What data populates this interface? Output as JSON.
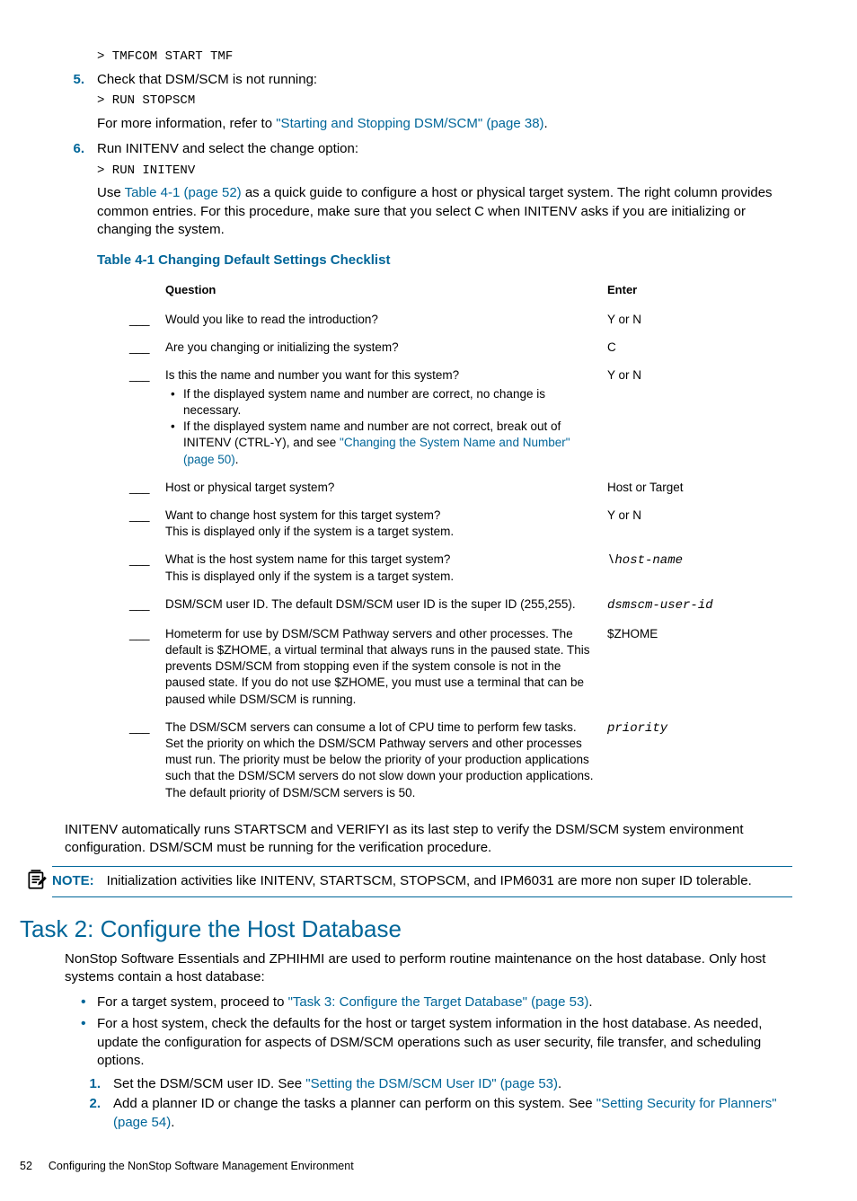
{
  "step5": {
    "num": "5.",
    "code": "> TMFCOM START TMF",
    "text": "Check that DSM/SCM is not running:",
    "code2": "> RUN STOPSCM",
    "info_prefix": "For more information, refer to ",
    "info_link": "\"Starting and Stopping DSM/SCM\" (page 38)",
    "info_suffix": "."
  },
  "step6": {
    "num": "6.",
    "text": "Run INITENV and select the change option:",
    "code": "> RUN INITENV",
    "use_prefix": "Use ",
    "use_link": "Table 4-1 (page 52)",
    "use_suffix": " as a quick guide to configure a host or physical target system. The right column provides common entries. For this procedure, make sure that you select C when INITENV asks if you are initializing or changing the system."
  },
  "table": {
    "title": "Table 4-1 Changing Default Settings Checklist",
    "h1": "Question",
    "h2": "Enter",
    "rows": [
      {
        "q": "Would you like to read the introduction?",
        "e": "Y or N"
      },
      {
        "q": "Are you changing or initializing the system?",
        "e": "C"
      },
      {
        "q": "Is this the name and number you want for this system?",
        "b1": "If the displayed system name and number are correct, no change is necessary.",
        "b2a": "If the displayed system name and number are not correct, break out of INITENV (CTRL-Y), and see ",
        "b2link": "\"Changing the System Name and Number\" (page 50)",
        "b2b": ".",
        "e": "Y or N"
      },
      {
        "q": "Host or physical target system?",
        "e": "Host or Target"
      },
      {
        "q": "Want to change host system for this target system?",
        "q2": "This is displayed only if the system is a target system.",
        "e": "Y or N"
      },
      {
        "q": "What is the host system name for this target system?",
        "q2": "This is displayed only if the system is a target system.",
        "e_code": "\\host-name"
      },
      {
        "q": "DSM/SCM user ID. The default DSM/SCM user ID is the super ID (255,255).",
        "e_code": "dsmscm-user-id"
      },
      {
        "q": "Hometerm for use by DSM/SCM Pathway servers and other processes. The default is $ZHOME, a virtual terminal that always runs in the paused state. This prevents DSM/SCM from stopping even if the system console is not in the paused state. If you do not use $ZHOME, you must use a terminal that can be paused while DSM/SCM is running.",
        "e": "$ZHOME"
      },
      {
        "q": "The DSM/SCM servers can consume a lot of CPU time to perform few tasks. Set the priority on which the DSM/SCM Pathway servers and other processes must run. The priority must be below the priority of your production applications such that the DSM/SCM servers do not slow down your production applications. The default priority of DSM/SCM servers is 50.",
        "e_code": "priority"
      }
    ]
  },
  "after_table": "INITENV automatically runs STARTSCM and VERIFYI as its last step to verify the DSM/SCM system environment configuration. DSM/SCM must be running for the verification procedure.",
  "note": {
    "label": "NOTE:",
    "text": "Initialization activities like INITENV, STARTSCM, STOPSCM, and IPM6031 are more non super ID tolerable."
  },
  "task2": {
    "heading": "Task 2: Configure the Host Database",
    "intro": "NonStop Software Essentials and ZPHIHMI are used to perform routine maintenance on the host database. Only host systems contain a host database:",
    "b1a": "For a target system, proceed to ",
    "b1link": "\"Task 3: Configure the Target Database\" (page 53)",
    "b1b": ".",
    "b2": "For a host system, check the defaults for the host or target system information in the host database. As needed, update the configuration for aspects of DSM/SCM operations such as user security, file transfer, and scheduling options.",
    "s1n": "1.",
    "s1a": "Set the DSM/SCM user ID. See ",
    "s1link": "\"Setting the DSM/SCM User ID\" (page 53)",
    "s1b": ".",
    "s2n": "2.",
    "s2a": "Add a planner ID or change the tasks a planner can perform on this system. See ",
    "s2link": "\"Setting Security for Planners\" (page 54)",
    "s2b": "."
  },
  "footer": {
    "page": "52",
    "title": "Configuring the NonStop Software Management Environment"
  }
}
